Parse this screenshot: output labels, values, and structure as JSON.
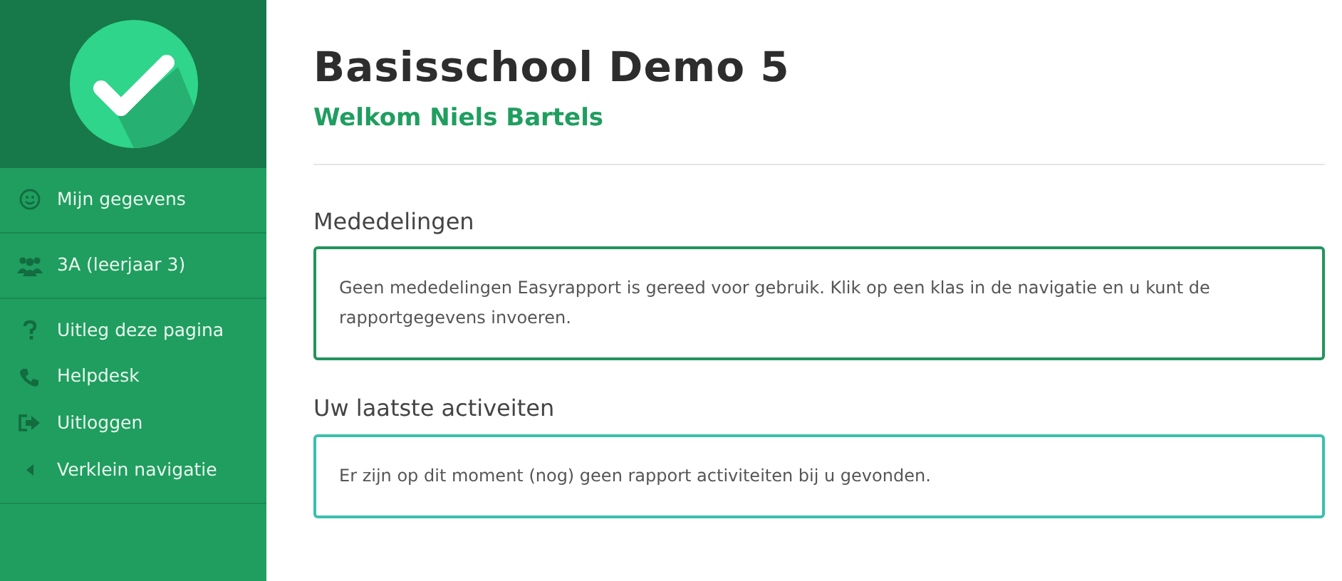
{
  "sidebar": {
    "sections": [
      {
        "items": [
          {
            "label": "Mijn gegevens"
          }
        ]
      },
      {
        "items": [
          {
            "label": "3A (leerjaar 3)"
          }
        ]
      },
      {
        "items": [
          {
            "label": "Uitleg deze pagina"
          },
          {
            "label": "Helpdesk"
          },
          {
            "label": "Uitloggen"
          },
          {
            "label": "Verklein navigatie"
          }
        ]
      }
    ]
  },
  "header": {
    "title": "Basisschool Demo 5",
    "subtitle": "Welkom Niels Bartels"
  },
  "panels": [
    {
      "heading": "Mededelingen",
      "color": "#23945c",
      "text": "Geen mededelingen Easyrapport is gereed voor gebruik. Klik op een klas in de navigatie en u kunt de rapportgegevens invoeren."
    },
    {
      "heading": "Uw laatste activeiten",
      "color": "#3bbfae",
      "text": "Er zijn op dit moment (nog) geen rapport activiteiten bij u gevonden."
    }
  ]
}
